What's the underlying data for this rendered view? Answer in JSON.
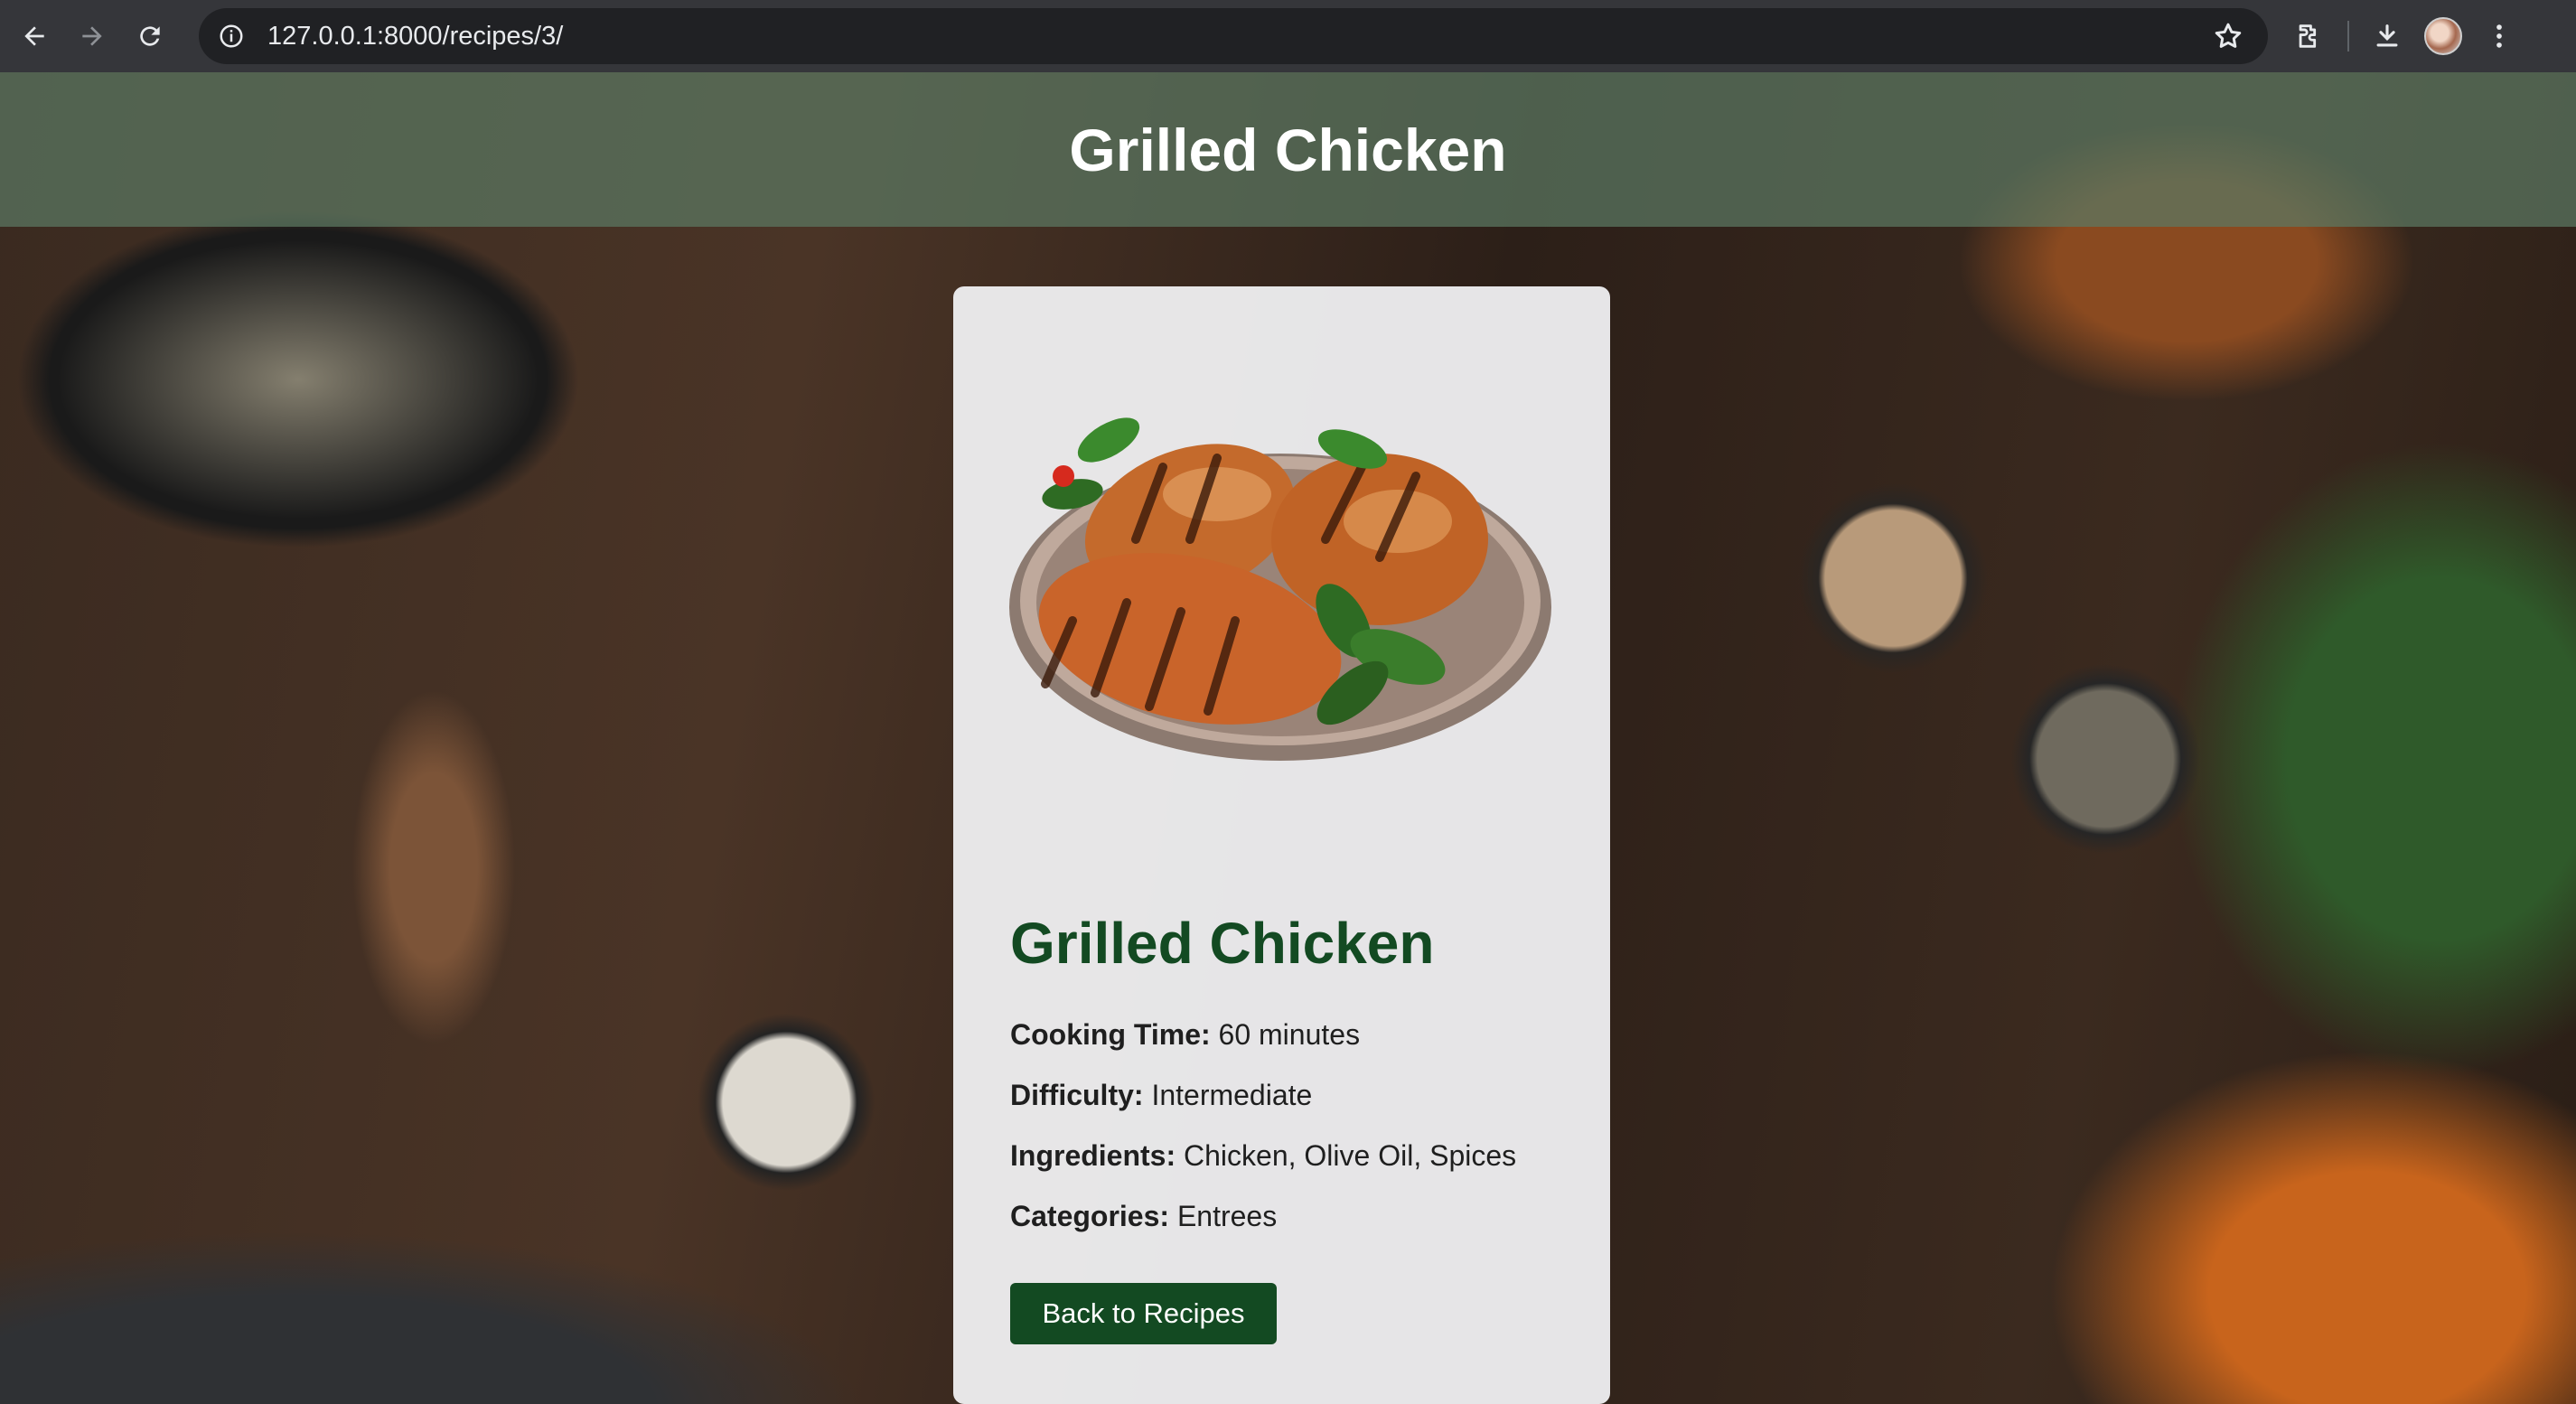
{
  "browser": {
    "url": "127.0.0.1:8000/recipes/3/",
    "icons": [
      "back-arrow-icon",
      "forward-arrow-icon",
      "reload-icon",
      "site-info-icon",
      "star-icon",
      "extensions-icon",
      "download-icon",
      "profile-avatar",
      "menu-dots-icon"
    ]
  },
  "header": {
    "title": "Grilled Chicken"
  },
  "recipe": {
    "title": "Grilled Chicken",
    "image_alt": "grilled-chicken-photo",
    "details": [
      {
        "label": "Cooking Time:",
        "value": "60 minutes"
      },
      {
        "label": "Difficulty:",
        "value": "Intermediate"
      },
      {
        "label": "Ingredients:",
        "value": "Chicken, Olive Oil, Spices"
      },
      {
        "label": "Categories:",
        "value": "Entrees"
      }
    ],
    "back_label": "Back to Recipes"
  },
  "colors": {
    "accent": "#134a22",
    "header_band": "#5c7862",
    "browser_bar": "#35363a"
  }
}
